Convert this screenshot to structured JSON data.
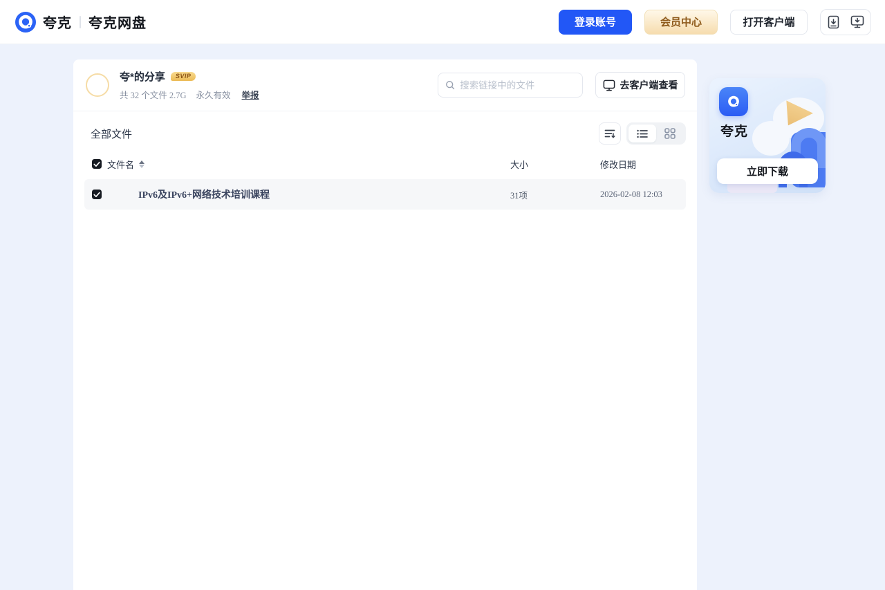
{
  "header": {
    "brand": "夸克",
    "product": "夸克网盘",
    "login_label": "登录账号",
    "vip_label": "会员中心",
    "open_client_label": "打开客户端"
  },
  "share": {
    "title": "夸*的分享",
    "badge": "SVIP",
    "files_count": "共 32 个文件 2.7G",
    "validity": "永久有效",
    "report_label": "举报",
    "search_placeholder": "搜索链接中的文件",
    "view_in_client_label": "去客户端查看"
  },
  "files": {
    "section_title": "全部文件",
    "columns": {
      "name": "文件名",
      "size": "大小",
      "date": "修改日期"
    },
    "rows": [
      {
        "name": "IPv6及IPv6+网络技术培训课程",
        "size": "31项",
        "date": "2026-02-08 12:03"
      }
    ]
  },
  "promo": {
    "app_name": "夸克",
    "download_label": "立即下载"
  },
  "colors": {
    "accent_blue": "#2257F6",
    "vip_text": "#8F5B1C",
    "vip_gold": "#F6DCAE",
    "page_bg": "#EDF2FC",
    "row_bg": "#F6F7F9",
    "checkbox": "#171B22"
  }
}
